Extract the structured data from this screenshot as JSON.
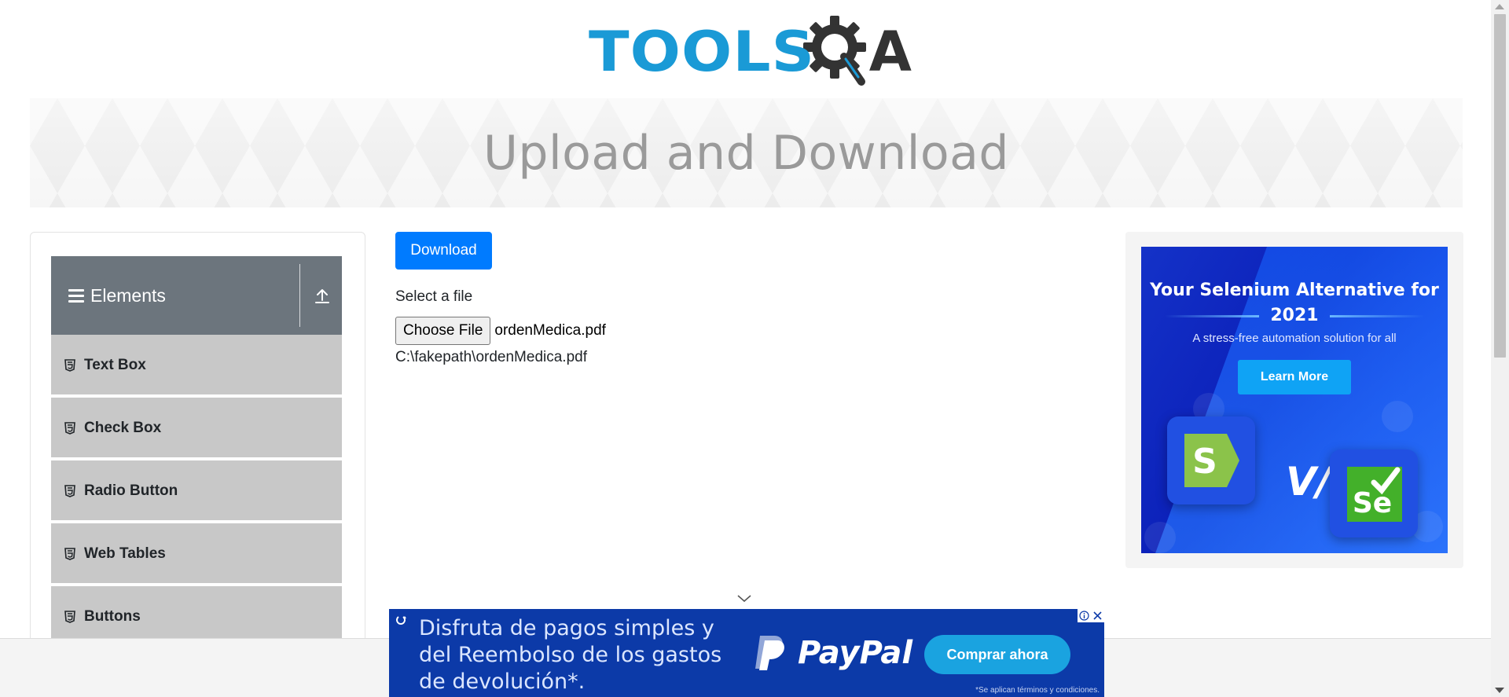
{
  "header": {
    "logo_text_tools": "TOOLS",
    "logo_text_a": "A",
    "logo_icon": "gear-magnifier-icon"
  },
  "banner": {
    "title": "Upload and Download"
  },
  "sidebar": {
    "group": {
      "label": "Elements",
      "menu_icon": "hamburger-icon",
      "toggle_icon": "upload-arrow-icon"
    },
    "items": [
      {
        "label": "Text Box",
        "icon": "html5-icon"
      },
      {
        "label": "Check Box",
        "icon": "html5-icon"
      },
      {
        "label": "Radio Button",
        "icon": "html5-icon"
      },
      {
        "label": "Web Tables",
        "icon": "html5-icon"
      },
      {
        "label": "Buttons",
        "icon": "html5-icon"
      }
    ]
  },
  "main": {
    "download_label": "Download",
    "select_label": "Select a file",
    "choose_file_label": "Choose File",
    "file_name": "ordenMedica.pdf",
    "uploaded_path": "C:\\fakepath\\ordenMedica.pdf"
  },
  "side_ad": {
    "title": "Your Selenium Alternative for 2021",
    "subtitle": "A stress-free automation solution for all",
    "cta": "Learn More",
    "vs_text": "V/s",
    "left_logo": "S",
    "right_logo": "Se",
    "colors": {
      "background": "#0b1fb8",
      "cta": "#0fa3f5"
    }
  },
  "bottom_ad": {
    "text": "Disfruta de pagos simples y del Reembolso de los gastos de devolución*.",
    "brand": "PayPal",
    "cta": "Comprar ahora",
    "fine_print": "*Se aplican términos y condiciones.",
    "colors": {
      "background": "#0c3aa8",
      "cta": "#1aa3e0"
    }
  },
  "colors": {
    "primary": "#007bff",
    "logo_blue": "#1a9ad6",
    "sidebar_header": "#6c757d",
    "sidebar_item": "#c8c8c8"
  }
}
